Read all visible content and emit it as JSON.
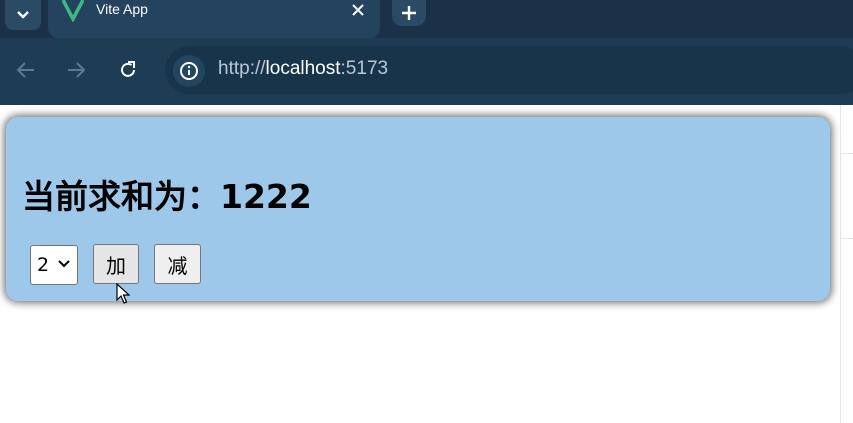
{
  "browser": {
    "tab": {
      "title": "Vite App",
      "favicon": "vite-logo-icon"
    },
    "address_bar": {
      "protocol": "http://",
      "host": "localhost",
      "port": ":5173"
    }
  },
  "page": {
    "sum_label": "当前求和为：",
    "sum_value": "1222",
    "step_select": {
      "selected": "2"
    },
    "add_button": "加",
    "subtract_button": "减"
  },
  "colors": {
    "card_background": "#9dc8e9",
    "browser_chrome": "#1f3c55",
    "tabstrip": "#1b3147"
  }
}
